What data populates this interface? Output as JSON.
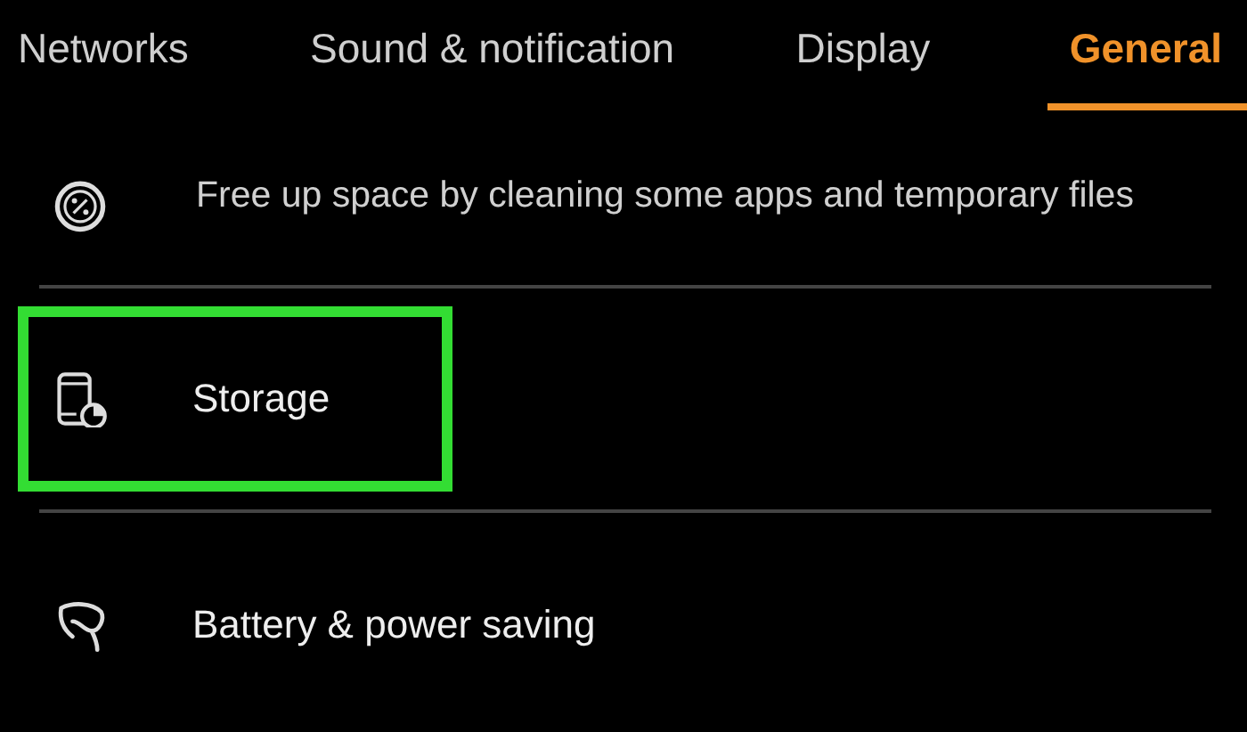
{
  "tabs": [
    {
      "label": "Networks",
      "selected": false
    },
    {
      "label": "Sound & notification",
      "selected": false
    },
    {
      "label": "Display",
      "selected": false
    },
    {
      "label": "General",
      "selected": true
    }
  ],
  "settings": [
    {
      "kind": "description",
      "description": "Free up space by cleaning some apps and temporary files",
      "highlighted": false
    },
    {
      "kind": "title",
      "title": "Storage",
      "highlighted": true
    },
    {
      "kind": "title",
      "title": "Battery & power saving",
      "highlighted": false
    }
  ]
}
